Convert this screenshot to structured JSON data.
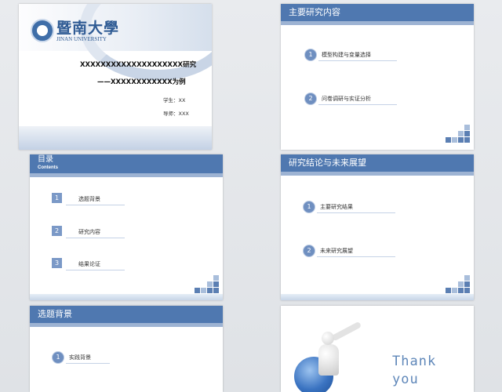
{
  "slides": {
    "title": {
      "logo_cn": "暨南大學",
      "logo_en": "JINAN UNIVERSITY",
      "title_line1": "XXXXXXXXXXXXXXXXXXXX研究",
      "title_line2": "——XXXXXXXXXXXX为例",
      "student": "学生：XX",
      "mentor": "导师：XXX"
    },
    "content": {
      "heading": "主要研究内容",
      "items": [
        {
          "num": "1",
          "label": "模型构建与变量选择"
        },
        {
          "num": "2",
          "label": "问卷调研与实证分析"
        }
      ]
    },
    "toc": {
      "heading": "目录",
      "subheading": "Contents",
      "items": [
        {
          "num": "1",
          "label": "选题背景"
        },
        {
          "num": "2",
          "label": "研究内容"
        },
        {
          "num": "3",
          "label": "结果论证"
        }
      ]
    },
    "conclusion": {
      "heading": "研究结论与未来展望",
      "items": [
        {
          "num": "1",
          "label": "主要研究结果"
        },
        {
          "num": "2",
          "label": "未来研究展望"
        }
      ]
    },
    "background": {
      "heading": "选题背景",
      "items": [
        {
          "num": "1",
          "label": "实践背景"
        }
      ]
    },
    "thanks": {
      "line1": "Thank",
      "line2": "you"
    }
  },
  "colors": {
    "accent": "#4f78b0",
    "accent_light": "#9db3d3",
    "block_dark": "#5b7fb3",
    "block_light": "#a9bedb"
  }
}
